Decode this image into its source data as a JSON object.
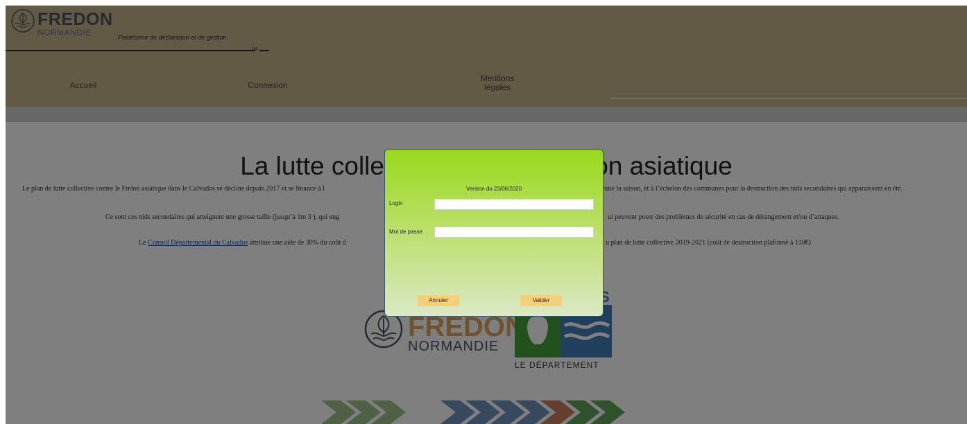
{
  "header": {
    "brand": "FREDON",
    "brand_sub": "NORMANDIE",
    "tagline": "Plateforme de déclaration et de gestion",
    "version_tag": "V4"
  },
  "nav": [
    {
      "label": "Accueil"
    },
    {
      "label": "Connexion"
    },
    {
      "label": "Mentions\nlégales"
    }
  ],
  "content": {
    "title": "La lutte collective contre le Frelon asiatique",
    "p1": "Le plan de lutte collective contre le Frelon asiatique dans le Calvados se décline depuis 2017 et se finance à l",
    "p1_right": "toute la saison, et à l’échelon des communes pour la destruction des nids secondaires qui apparaissent en été.",
    "p2": "Ce sont ces nids secondaires qui atteignent une grosse taille (jusqu’à 1m 3 ), qui eng",
    "p2_right": "ui peuvent poser des problèmes de sécurité en cas de dérangement et/ou d’attaques.",
    "p3_prefix": "Le ",
    "p3_link": "Conseil Départemental du Calvados",
    "p3_mid": " attribue une aide de 30% du coût d",
    "p3_right": "u plan de lutte collective 2019-2021 (coût de destruction plafonné à 110€)"
  },
  "partners": {
    "fredon_brand": "FREDON",
    "fredon_sub": "NORMANDIE",
    "departement": "LE DÉPARTEMENT",
    "dept_letter": "S"
  },
  "modal": {
    "version": "Version du 23/06/2020",
    "login_label": "Login",
    "login_value": "",
    "password_label": "Mot de passe",
    "password_value": "",
    "cancel_label": "Annuler",
    "submit_label": "Valider"
  },
  "colors": {
    "header_bg": "#c7b48a",
    "modal_top": "#98d91c",
    "modal_bottom": "#dbe9c6",
    "button_bg": "#f5cf7a",
    "link": "#1a4fa0"
  }
}
